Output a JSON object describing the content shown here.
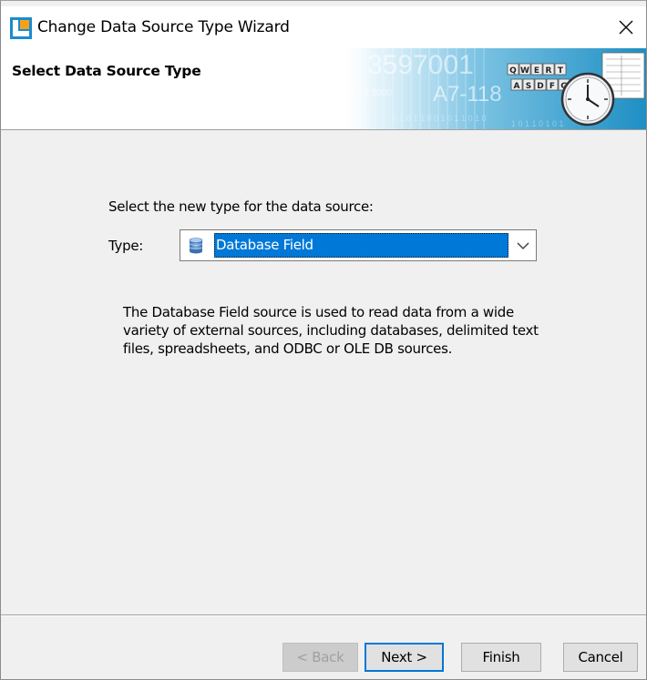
{
  "window": {
    "title": "Change Data Source Type Wizard",
    "icon": "wizard-app-icon",
    "close_icon": "close-icon"
  },
  "banner": {
    "title": "Select Data Source Type",
    "art": {
      "big_number": "3597001",
      "code": "A7-118",
      "date_text": "4 7 2000",
      "keys_row1": [
        "Q",
        "W",
        "E",
        "R",
        "T"
      ],
      "keys_row2": [
        "A",
        "S",
        "D",
        "F",
        "G"
      ]
    }
  },
  "form": {
    "prompt": "Select the new type for the data source:",
    "type_label": "Type:",
    "type_value": "Database Field",
    "type_icon": "database-icon",
    "dropdown_icon": "chevron-down-icon",
    "description": "The Database Field source is used to read data from a wide variety of external sources, including databases, delimited text files, spreadsheets, and ODBC or OLE DB sources."
  },
  "buttons": {
    "back": "< Back",
    "next": "Next >",
    "finish": "Finish",
    "cancel": "Cancel"
  },
  "colors": {
    "accent": "#0078d7",
    "dialog_bg": "#f0f0f0",
    "banner_blue": "#1e8fc4"
  }
}
